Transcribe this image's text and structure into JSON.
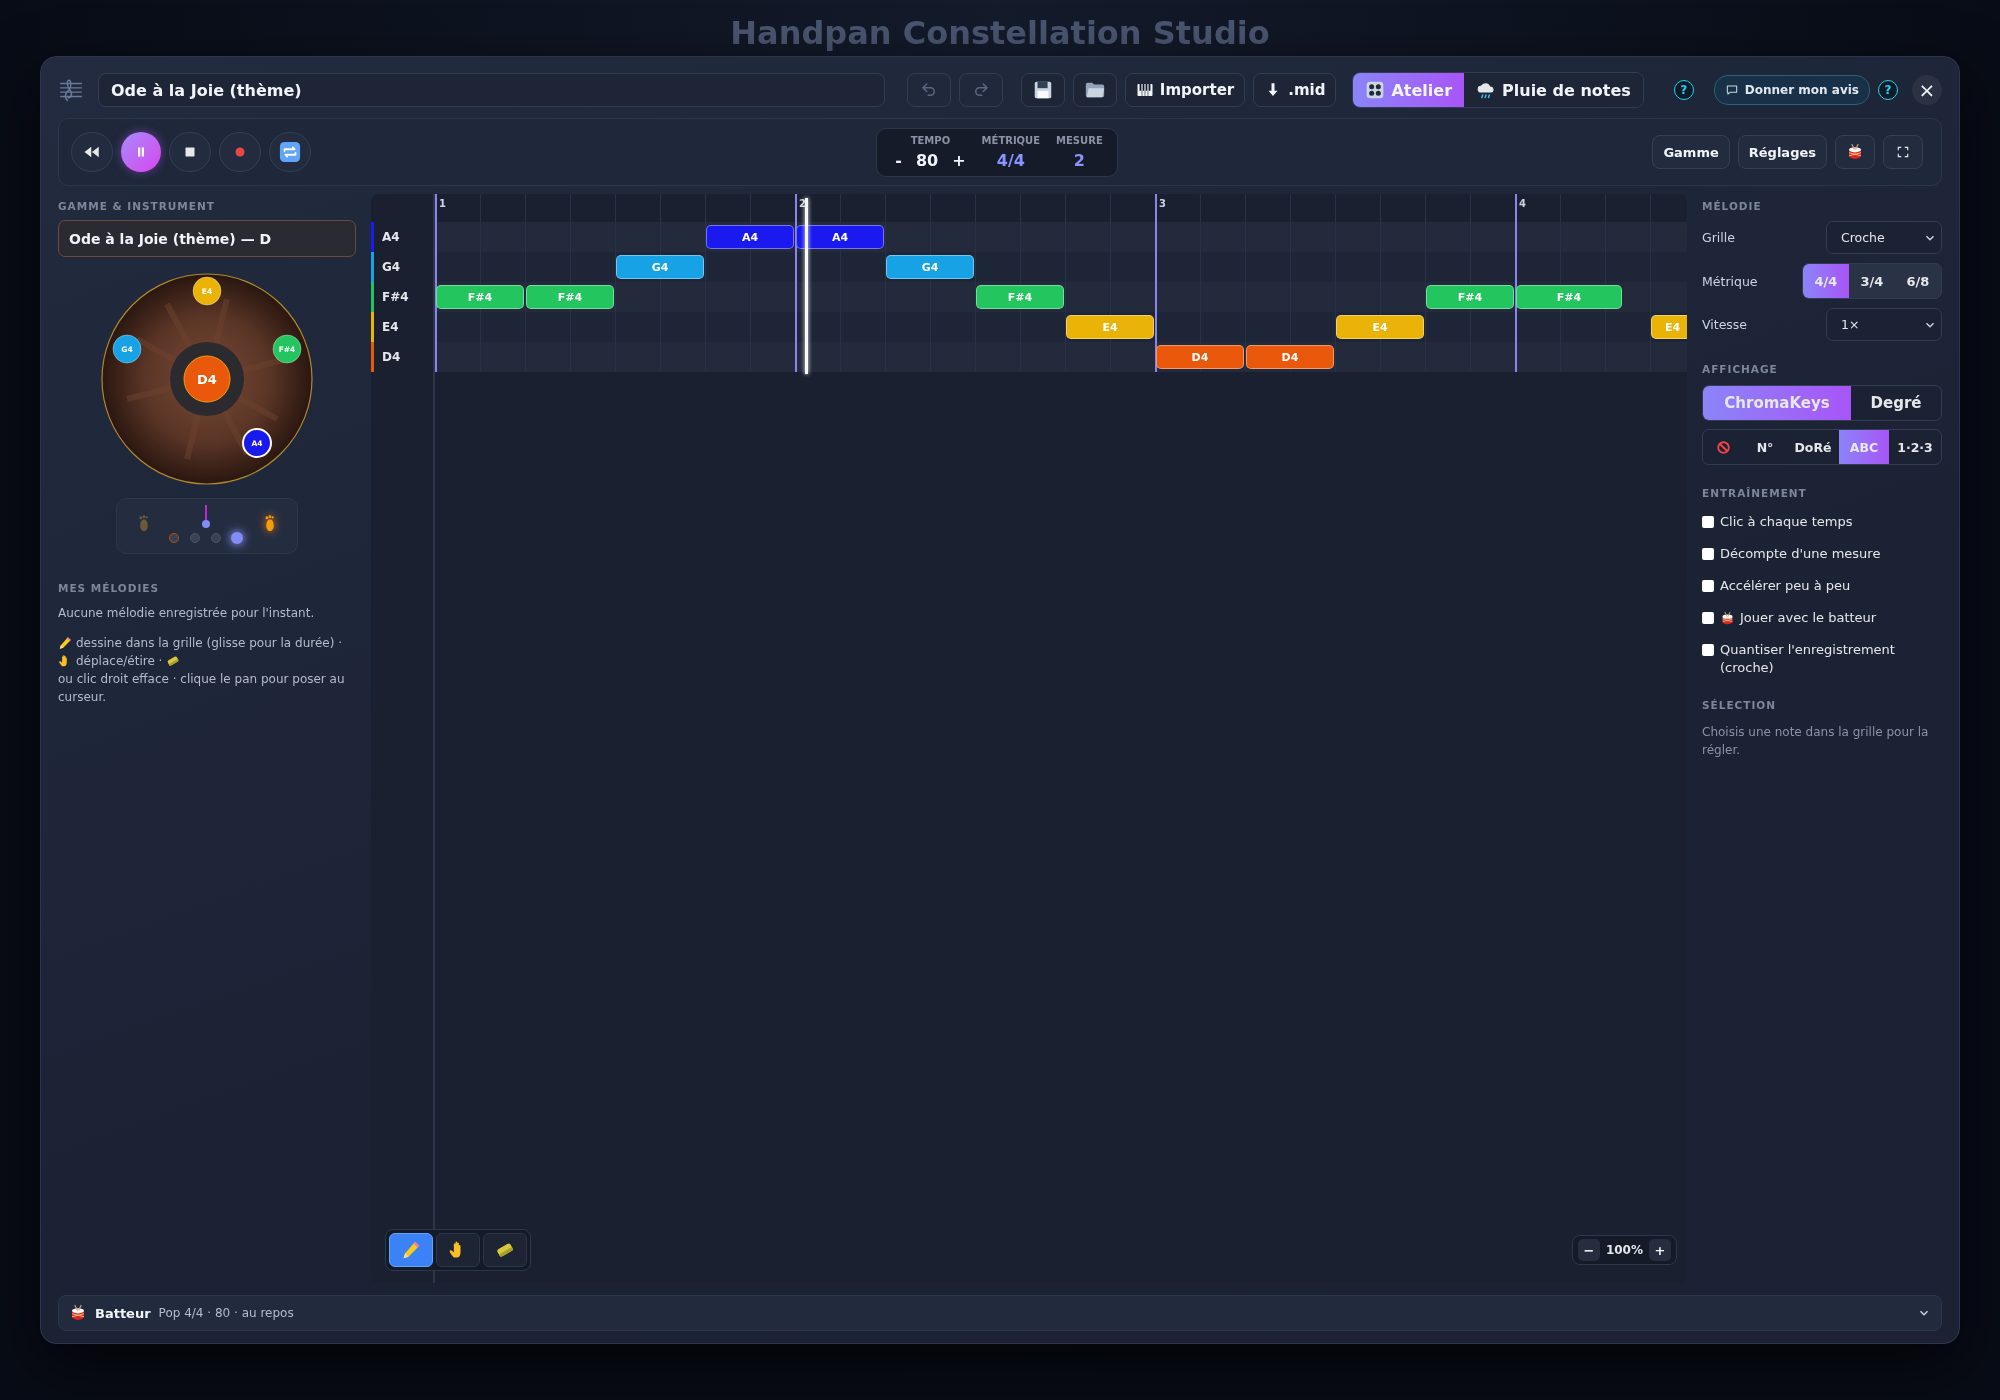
{
  "backdrop": {
    "title": "Handpan Constellation Studio"
  },
  "header": {
    "title_field": {
      "value": "Ode à la Joie (thème)"
    },
    "icon_buttons": [
      {
        "kind": "undo",
        "disabled": true
      },
      {
        "kind": "redo",
        "disabled": true
      },
      {
        "kind": "save",
        "disabled": false
      },
      {
        "kind": "open",
        "disabled": false
      }
    ],
    "import_buttons": [
      {
        "kind": "piano",
        "label": "Importer"
      },
      {
        "kind": "download",
        "label": ".mid"
      }
    ],
    "view_tabs": [
      {
        "kind": "atelier",
        "label": "Atelier",
        "selected": true
      },
      {
        "kind": "rain",
        "label": "Pluie de notes",
        "selected": false
      }
    ],
    "help": "?",
    "feedback": {
      "label": "Donner mon avis"
    },
    "help_secondary": "?",
    "close": "×"
  },
  "transport": [
    {
      "kind": "rewind",
      "selected": false
    },
    {
      "kind": "pause",
      "selected": true
    },
    {
      "kind": "stop",
      "selected": false
    },
    {
      "kind": "record",
      "selected": false
    },
    {
      "kind": "loop",
      "selected": false
    }
  ],
  "tempo": {
    "label": "TEMPO",
    "minus": "-",
    "value": "80",
    "plus": "+"
  },
  "meter": {
    "label": "MÉTRIQUE",
    "value": "4/4"
  },
  "measure": {
    "label": "MESURE",
    "value": "2"
  },
  "toolbar_right": [
    {
      "kind": "text",
      "label": "Gamme"
    },
    {
      "kind": "text",
      "label": "Réglages"
    },
    {
      "kind": "drum"
    },
    {
      "kind": "fullscreen"
    }
  ],
  "left": {
    "section": "GAMME & INSTRUMENT",
    "scale": "Ode à la Joie (thème) — D",
    "handpan": {
      "center": {
        "note": "D4",
        "color": "#ea580c"
      },
      "tones": [
        {
          "note": "E4",
          "color": "#eab308",
          "active": false
        },
        {
          "note": "G4",
          "color": "#17a2e6",
          "active": false
        },
        {
          "note": "F#4",
          "color": "#22c55e",
          "active": false
        },
        {
          "note": "A4",
          "color": "#1a1af0",
          "active": true
        }
      ]
    },
    "pedal": {
      "feet": [
        {
          "active": false
        },
        {
          "active": true
        }
      ],
      "beats": [
        {
          "selected": false,
          "accent": true
        },
        {
          "selected": false,
          "accent": false
        },
        {
          "selected": false,
          "accent": false
        },
        {
          "selected": true,
          "accent": false
        }
      ]
    },
    "melodies_section": "MES MÉLODIES",
    "melodies_empty": "Aucune mélodie enregistrée pour l'instant.",
    "help": [
      {
        "kind": "pencil",
        "text": "dessine dans la grille (glisse pour la durée) ·"
      },
      {
        "kind": "hand",
        "text": "déplace/étire ·"
      },
      {
        "kind": "eraser",
        "text": "ou clic droit efface · clique le pan pour poser au curseur."
      }
    ]
  },
  "grid": {
    "measures": [
      "1",
      "2",
      "3",
      "4"
    ],
    "rows": [
      {
        "note": "A4",
        "color": "#1a1af0"
      },
      {
        "note": "G4",
        "color": "#17a2e6"
      },
      {
        "note": "F#4",
        "color": "#22c55e"
      },
      {
        "note": "E4",
        "color": "#eab308"
      },
      {
        "note": "D4",
        "color": "#ea580c"
      }
    ],
    "notes": [
      {
        "label": "F#4",
        "color": "#22c55e",
        "kind": "eighth"
      },
      {
        "label": "F#4",
        "color": "#22c55e",
        "kind": "eighth"
      },
      {
        "label": "G4",
        "color": "#17a2e6",
        "kind": "eighth"
      },
      {
        "label": "A4",
        "color": "#1a1af0",
        "kind": "eighth"
      },
      {
        "label": "A4",
        "color": "#1a1af0",
        "kind": "eighth"
      },
      {
        "label": "G4",
        "color": "#17a2e6",
        "kind": "eighth"
      },
      {
        "label": "F#4",
        "color": "#22c55e",
        "kind": "eighth"
      },
      {
        "label": "E4",
        "color": "#eab308",
        "kind": "eighth"
      },
      {
        "label": "D4",
        "color": "#ea580c",
        "kind": "eighth"
      },
      {
        "label": "D4",
        "color": "#ea580c",
        "kind": "eighth"
      },
      {
        "label": "E4",
        "color": "#eab308",
        "kind": "eighth"
      },
      {
        "label": "F#4",
        "color": "#22c55e",
        "kind": "eighth"
      },
      {
        "label": "F#4",
        "color": "#22c55e",
        "kind": "dotted"
      },
      {
        "label": "E4",
        "color": "#eab308",
        "kind": "sixteenth"
      }
    ],
    "playhead": {
      "level": 0.296
    },
    "tools": [
      {
        "kind": "pencil",
        "selected": true
      },
      {
        "kind": "hand",
        "selected": false
      },
      {
        "kind": "eraser",
        "selected": false
      }
    ],
    "zoom": {
      "minus": "−",
      "value": "100%",
      "plus": "+"
    }
  },
  "right": {
    "melody_section": "MÉLODIE",
    "grid_select": {
      "label": "Grille",
      "value": "Croche"
    },
    "meter": {
      "label": "Métrique",
      "options": [
        {
          "label": "4/4",
          "selected": true
        },
        {
          "label": "3/4",
          "selected": false
        },
        {
          "label": "6/8",
          "selected": false
        }
      ]
    },
    "speed_select": {
      "label": "Vitesse",
      "value": "1×"
    },
    "display_section": "AFFICHAGE",
    "color_modes": [
      {
        "label": "ChromaKeys",
        "selected": true
      },
      {
        "label": "Degré",
        "selected": false
      }
    ],
    "label_modes": [
      {
        "kind": "none",
        "selected": false
      },
      {
        "kind": "text",
        "label": "N°",
        "selected": false
      },
      {
        "kind": "text",
        "label": "DoRé",
        "selected": false
      },
      {
        "kind": "text",
        "label": "ABC",
        "selected": true
      },
      {
        "kind": "text",
        "label": "1·2·3",
        "selected": false
      }
    ],
    "training_section": "ENTRAÎNEMENT",
    "training": [
      {
        "kind": "plain",
        "label": "Clic à chaque temps",
        "checked": false
      },
      {
        "kind": "plain",
        "label": "Décompte d'une mesure",
        "checked": false
      },
      {
        "kind": "plain",
        "label": "Accélérer peu à peu",
        "checked": false
      },
      {
        "kind": "drum",
        "label": "Jouer avec le batteur",
        "checked": false
      },
      {
        "kind": "plain",
        "label": "Quantiser l'enregistrement (croche)",
        "checked": false
      }
    ],
    "selection_section": "SÉLECTION",
    "selection_text": "Choisis une note dans la grille pour la régler."
  },
  "drummer_bar": {
    "name": "Batteur",
    "status": "Pop 4/4 · 80 · au repos",
    "expanded": false
  }
}
